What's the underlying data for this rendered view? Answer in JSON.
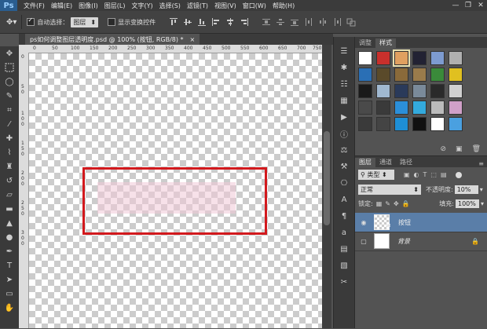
{
  "app": {
    "logo": "Ps"
  },
  "menu": [
    "文件(F)",
    "编辑(E)",
    "图像(I)",
    "图层(L)",
    "文字(Y)",
    "选择(S)",
    "滤镜(T)",
    "视图(V)",
    "窗口(W)",
    "帮助(H)"
  ],
  "window_controls": {
    "minimize": "—",
    "restore": "❐",
    "close": "✕"
  },
  "options": {
    "auto_select_label": "自动选择：",
    "auto_select_value": "图层",
    "show_transform_label": "显示变换控件"
  },
  "document": {
    "tab_title": "ps如何调整图层透明度.psd @ 100% (按钮, RGB/8) *",
    "close": "×"
  },
  "ruler": {
    "top": [
      "0",
      "50",
      "100",
      "150",
      "200",
      "250",
      "300",
      "350",
      "400",
      "450",
      "500",
      "550",
      "600",
      "650",
      "700",
      "750"
    ],
    "left": [
      "0",
      "5",
      "0",
      "1",
      "0",
      "0",
      "1",
      "5",
      "0",
      "2",
      "0",
      "0",
      "2",
      "5",
      "0",
      "3",
      "0",
      "0"
    ]
  },
  "styles_panel": {
    "tabs": [
      "调整",
      "样式"
    ],
    "swatches": [
      "#ffffff",
      "#c9302c",
      "#e0a060",
      "#222233",
      "#7d9bd0",
      "#b0b0b0",
      "#2a6fb5",
      "#5a4a2a",
      "#8a6a3a",
      "#9a7b4b",
      "#3a8a3a",
      "#e0c020",
      "#1a1a1a",
      "#a0b8d0",
      "#2a3a5a",
      "#7a8a9a",
      "#2a2a2a",
      "#d0d0d0",
      "#4a4a4a",
      "#3a3a3a",
      "#2b8fd9",
      "#33aadd",
      "#bbbbbb",
      "#d0a0c8",
      "#3a3a3a",
      "#444444",
      "#1e8fd6",
      "#111111",
      "#ffffff",
      "#4aa0e0"
    ]
  },
  "layers_panel": {
    "tabs": [
      "图层",
      "通道",
      "路径"
    ],
    "filter_label": "类型",
    "blend_mode": "正常",
    "opacity_label": "不透明度:",
    "opacity_value": "10%",
    "lock_label": "锁定:",
    "fill_label": "填充:",
    "fill_value": "100%",
    "layers": [
      {
        "name": "按钮",
        "selected": true
      },
      {
        "name": "背景",
        "selected": false
      }
    ]
  },
  "colors": {
    "highlight": "#d2191d",
    "selection": "#5a7ea8"
  }
}
